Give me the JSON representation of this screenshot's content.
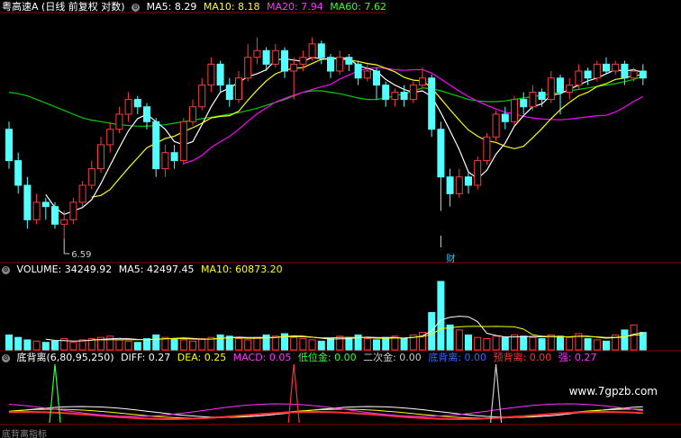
{
  "main_header": {
    "title": "粤高速A (日线 前复权 对数)",
    "ma5": "MA5: 8.29",
    "ma10": "MA10: 8.18",
    "ma20": "MA20: 7.94",
    "ma60": "MA60: 7.62"
  },
  "low_label": "6.59",
  "event_label": "财",
  "volume_header": {
    "volume": "VOLUME: 34249.92",
    "ma5": "MA5: 42497.45",
    "ma10": "MA10: 60873.20"
  },
  "indicator_header": {
    "name": "底背离(6,80,95,250)",
    "diff": "DIFF: 0.27",
    "dea": "DEA: 0.25",
    "macd": "MACD: 0.05",
    "low_gold": "低位金: 0.00",
    "second_gold": "二次金: 0.00",
    "bottom_div": "底背离: 0.00",
    "pre_div": "预背离: 0.00",
    "strong": "强: 0.27"
  },
  "watermark": "www.7gpzb.com",
  "footer_text": "底背离指标",
  "colors": {
    "up": "#ff3c3c",
    "down": "#54ffff",
    "ma5": "#ffffff",
    "ma10": "#ffff00",
    "ma20": "#ff00ff",
    "ma60": "#00cc00",
    "grid": "#8b0000"
  },
  "chart_data": {
    "type": "candlestick",
    "title": "粤高速A (日线 前复权 对数)",
    "low_marker": 6.59,
    "price_range_estimated": [
      6.4,
      9.5
    ],
    "candles": [
      {
        "o": 7.9,
        "c": 7.5,
        "h": 8.0,
        "l": 7.4
      },
      {
        "o": 7.5,
        "c": 7.2,
        "h": 7.6,
        "l": 7.1
      },
      {
        "o": 7.2,
        "c": 6.8,
        "h": 7.3,
        "l": 6.7
      },
      {
        "o": 6.8,
        "c": 7.0,
        "h": 7.1,
        "l": 6.75
      },
      {
        "o": 7.0,
        "c": 6.95,
        "h": 7.05,
        "l": 6.8
      },
      {
        "o": 6.95,
        "c": 6.75,
        "h": 7.0,
        "l": 6.7
      },
      {
        "o": 6.75,
        "c": 6.8,
        "h": 6.9,
        "l": 6.59
      },
      {
        "o": 6.8,
        "c": 7.0,
        "h": 7.05,
        "l": 6.75
      },
      {
        "o": 7.0,
        "c": 7.2,
        "h": 7.25,
        "l": 6.95
      },
      {
        "o": 7.2,
        "c": 7.4,
        "h": 7.5,
        "l": 7.15
      },
      {
        "o": 7.4,
        "c": 7.7,
        "h": 7.8,
        "l": 7.35
      },
      {
        "o": 7.7,
        "c": 7.9,
        "h": 8.0,
        "l": 7.6
      },
      {
        "o": 7.9,
        "c": 8.1,
        "h": 8.2,
        "l": 7.85
      },
      {
        "o": 8.1,
        "c": 8.3,
        "h": 8.4,
        "l": 8.0
      },
      {
        "o": 8.3,
        "c": 8.2,
        "h": 8.35,
        "l": 8.1
      },
      {
        "o": 8.2,
        "c": 8.0,
        "h": 8.25,
        "l": 7.9
      },
      {
        "o": 8.0,
        "c": 7.4,
        "h": 8.05,
        "l": 7.3
      },
      {
        "o": 7.4,
        "c": 7.6,
        "h": 7.7,
        "l": 7.3
      },
      {
        "o": 7.6,
        "c": 7.5,
        "h": 7.7,
        "l": 7.4
      },
      {
        "o": 7.5,
        "c": 8.0,
        "h": 8.05,
        "l": 7.45
      },
      {
        "o": 8.0,
        "c": 8.2,
        "h": 8.3,
        "l": 7.95
      },
      {
        "o": 8.2,
        "c": 8.5,
        "h": 8.6,
        "l": 8.15
      },
      {
        "o": 8.5,
        "c": 8.8,
        "h": 8.9,
        "l": 8.4
      },
      {
        "o": 8.8,
        "c": 8.5,
        "h": 8.85,
        "l": 8.4
      },
      {
        "o": 8.5,
        "c": 8.3,
        "h": 8.6,
        "l": 8.2
      },
      {
        "o": 8.3,
        "c": 8.6,
        "h": 8.7,
        "l": 8.25
      },
      {
        "o": 8.6,
        "c": 8.9,
        "h": 9.1,
        "l": 8.55
      },
      {
        "o": 8.9,
        "c": 9.0,
        "h": 9.2,
        "l": 8.8
      },
      {
        "o": 9.0,
        "c": 8.8,
        "h": 9.05,
        "l": 8.7
      },
      {
        "o": 8.8,
        "c": 9.0,
        "h": 9.1,
        "l": 8.75
      },
      {
        "o": 9.0,
        "c": 8.7,
        "h": 9.05,
        "l": 8.6
      },
      {
        "o": 8.7,
        "c": 8.8,
        "h": 8.9,
        "l": 8.3
      },
      {
        "o": 8.8,
        "c": 8.9,
        "h": 9.0,
        "l": 8.7
      },
      {
        "o": 8.9,
        "c": 9.1,
        "h": 9.2,
        "l": 8.85
      },
      {
        "o": 9.1,
        "c": 8.9,
        "h": 9.15,
        "l": 8.8
      },
      {
        "o": 8.9,
        "c": 8.7,
        "h": 8.95,
        "l": 8.6
      },
      {
        "o": 8.7,
        "c": 8.9,
        "h": 9.0,
        "l": 8.65
      },
      {
        "o": 8.9,
        "c": 8.8,
        "h": 8.95,
        "l": 8.7
      },
      {
        "o": 8.8,
        "c": 8.6,
        "h": 8.85,
        "l": 8.5
      },
      {
        "o": 8.6,
        "c": 8.7,
        "h": 8.8,
        "l": 8.55
      },
      {
        "o": 8.7,
        "c": 8.5,
        "h": 8.75,
        "l": 8.3
      },
      {
        "o": 8.5,
        "c": 8.3,
        "h": 8.55,
        "l": 8.2
      },
      {
        "o": 8.3,
        "c": 8.4,
        "h": 8.45,
        "l": 8.2
      },
      {
        "o": 8.4,
        "c": 8.3,
        "h": 8.5,
        "l": 8.2
      },
      {
        "o": 8.3,
        "c": 8.5,
        "h": 8.55,
        "l": 8.25
      },
      {
        "o": 8.5,
        "c": 8.6,
        "h": 8.75,
        "l": 8.45
      },
      {
        "o": 8.6,
        "c": 7.9,
        "h": 8.65,
        "l": 7.8
      },
      {
        "o": 7.9,
        "c": 7.3,
        "h": 8.0,
        "l": 6.9
      },
      {
        "o": 7.3,
        "c": 7.1,
        "h": 7.4,
        "l": 6.95
      },
      {
        "o": 7.1,
        "c": 7.3,
        "h": 7.4,
        "l": 7.05
      },
      {
        "o": 7.3,
        "c": 7.2,
        "h": 7.35,
        "l": 7.1
      },
      {
        "o": 7.2,
        "c": 7.5,
        "h": 7.55,
        "l": 7.15
      },
      {
        "o": 7.5,
        "c": 7.8,
        "h": 7.85,
        "l": 7.45
      },
      {
        "o": 7.8,
        "c": 8.1,
        "h": 8.15,
        "l": 7.75
      },
      {
        "o": 8.1,
        "c": 8.0,
        "h": 8.2,
        "l": 7.9
      },
      {
        "o": 8.0,
        "c": 8.3,
        "h": 8.35,
        "l": 7.95
      },
      {
        "o": 8.3,
        "c": 8.2,
        "h": 8.4,
        "l": 8.1
      },
      {
        "o": 8.2,
        "c": 8.4,
        "h": 8.5,
        "l": 8.15
      },
      {
        "o": 8.4,
        "c": 8.3,
        "h": 8.45,
        "l": 8.2
      },
      {
        "o": 8.3,
        "c": 8.6,
        "h": 8.7,
        "l": 8.25
      },
      {
        "o": 8.6,
        "c": 8.4,
        "h": 8.65,
        "l": 8.1
      },
      {
        "o": 8.4,
        "c": 8.5,
        "h": 8.6,
        "l": 8.3
      },
      {
        "o": 8.5,
        "c": 8.7,
        "h": 8.8,
        "l": 8.45
      },
      {
        "o": 8.7,
        "c": 8.6,
        "h": 8.75,
        "l": 8.5
      },
      {
        "o": 8.6,
        "c": 8.8,
        "h": 8.85,
        "l": 8.55
      },
      {
        "o": 8.8,
        "c": 8.7,
        "h": 8.9,
        "l": 8.65
      },
      {
        "o": 8.7,
        "c": 8.8,
        "h": 8.85,
        "l": 8.65
      },
      {
        "o": 8.8,
        "c": 8.6,
        "h": 8.85,
        "l": 8.5
      },
      {
        "o": 8.6,
        "c": 8.7,
        "h": 8.75,
        "l": 8.55
      },
      {
        "o": 8.7,
        "c": 8.6,
        "h": 8.8,
        "l": 8.5
      }
    ],
    "ma60": [
      8.4,
      8.38,
      8.35,
      8.3,
      8.25,
      8.2,
      8.15,
      8.1,
      8.05,
      8.02,
      8.0,
      7.98,
      7.96,
      7.95,
      7.94,
      7.94,
      7.95,
      7.96,
      7.98,
      8.0,
      8.02,
      8.04,
      8.06,
      8.08,
      8.1,
      8.12,
      8.15,
      8.18,
      8.22,
      8.26,
      8.3,
      8.35,
      8.4,
      8.42,
      8.42,
      8.4,
      8.38,
      8.35,
      8.32,
      8.3,
      8.3,
      8.32,
      8.35,
      8.38,
      8.42,
      8.46,
      8.45,
      8.42,
      8.38,
      8.34,
      8.3,
      8.28,
      8.27,
      8.27,
      8.28,
      8.3,
      8.32,
      8.34,
      8.36,
      8.38,
      8.4,
      8.42,
      8.44,
      8.46,
      8.48,
      8.5,
      8.52,
      8.55,
      8.58,
      8.62
    ],
    "volume": [
      12,
      10,
      8,
      7,
      6,
      7,
      9,
      6,
      8,
      9,
      10,
      11,
      8,
      7,
      6,
      9,
      12,
      10,
      9,
      8,
      7,
      9,
      10,
      12,
      11,
      9,
      8,
      10,
      12,
      11,
      13,
      10,
      9,
      8,
      7,
      9,
      11,
      10,
      12,
      9,
      8,
      10,
      11,
      9,
      12,
      14,
      30,
      55,
      20,
      16,
      12,
      10,
      9,
      11,
      10,
      12,
      11,
      10,
      9,
      12,
      11,
      10,
      13,
      9,
      8,
      7,
      12,
      16,
      20,
      14
    ],
    "volume_range": [
      0,
      60000
    ],
    "indicator_signals": [
      {
        "index": 5,
        "value": 1.0
      },
      {
        "index": 31,
        "value": 1.0
      },
      {
        "index": 53,
        "value": 1.0
      }
    ]
  }
}
